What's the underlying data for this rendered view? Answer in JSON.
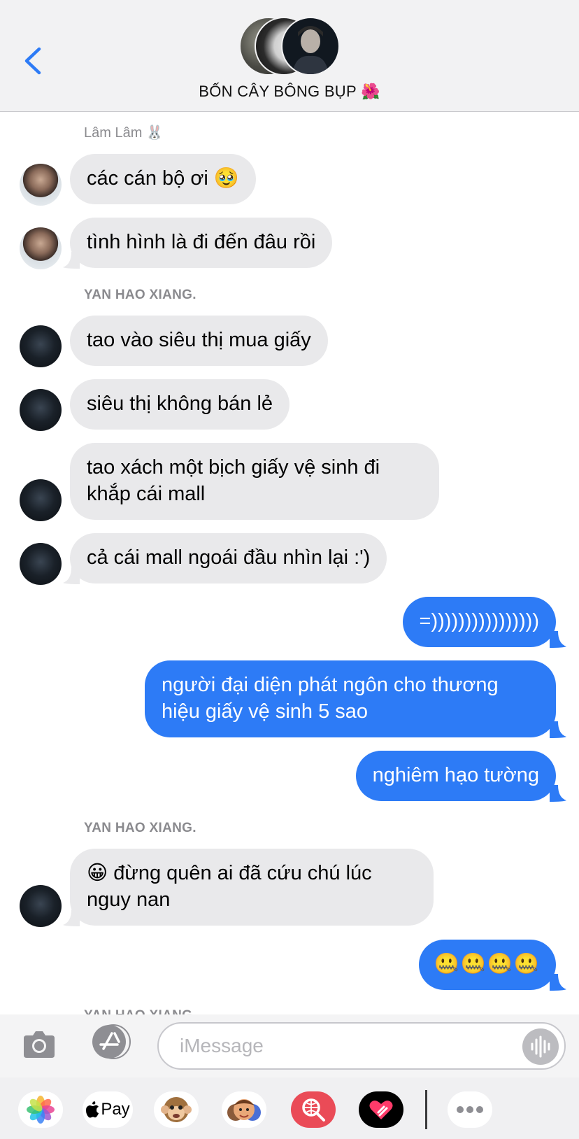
{
  "header": {
    "title": "BỐN CÂY BÔNG BỤP 🌺"
  },
  "senders": {
    "lam": "Lâm Lâm 🐰",
    "yan1": "YAN HAO XIANG.",
    "yan2": "YAN HAO XIANG.",
    "yan3": "YAN HAO XIANG."
  },
  "messages": [
    {
      "text": "các cán bộ ơi 🥹"
    },
    {
      "text": "tình hình là đi đến đâu rồi"
    },
    {
      "text": "tao vào siêu thị mua giấy"
    },
    {
      "text": "siêu thị không bán lẻ"
    },
    {
      "text": "tao xách một bịch giấy vệ sinh đi khắp cái mall"
    },
    {
      "text": "cả cái mall ngoái đầu nhìn lại :')"
    },
    {
      "text": "=))))))))))))))))"
    },
    {
      "text": "người đại diện phát ngôn cho thương hiệu giấy vệ sinh 5 sao"
    },
    {
      "text": "nghiêm hạo tường"
    },
    {
      "text": "😀 đừng quên ai đã cứu chú lúc nguy nan"
    },
    {
      "text": "🤐🤐🤐🤐"
    }
  ],
  "compose": {
    "placeholder": "iMessage"
  },
  "apps": {
    "applepay": "Pay"
  },
  "icons": [
    "chevron-left-icon",
    "camera-icon",
    "app-store-icon",
    "audio-wave-icon",
    "photos-icon",
    "apple-pay-icon",
    "animoji-icon",
    "memoji-icon",
    "web-search-icon",
    "digital-touch-icon",
    "more-icon"
  ]
}
